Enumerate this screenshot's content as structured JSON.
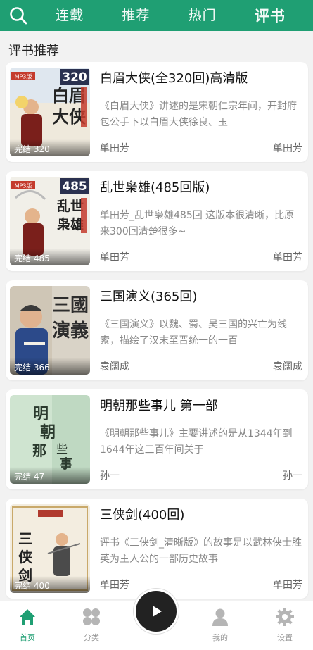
{
  "header": {
    "tabs": [
      {
        "label": "连载"
      },
      {
        "label": "推荐"
      },
      {
        "label": "热门"
      },
      {
        "label": "评书"
      }
    ],
    "active_tab": "评书",
    "accent_color": "#1f9f73"
  },
  "section": {
    "title": "评书推荐"
  },
  "books": [
    {
      "title": "白眉大侠(全320回)高清版",
      "description": "《白眉大侠》讲述的是宋朝仁宗年间，开封府包公手下以白眉大侠徐良、玉",
      "author": "单田芳",
      "narrator": "单田芳",
      "badge": "完结 320",
      "cover_text": "白眉大侠",
      "cover_tag": "MP3版",
      "cover_number": "320"
    },
    {
      "title": "乱世枭雄(485回版)",
      "description": "单田芳_乱世枭雄485回  这版本很清晰，比原来300回清楚很多~",
      "author": "单田芳",
      "narrator": "单田芳",
      "badge": "完结 485",
      "cover_text": "乱世枭雄",
      "cover_tag": "MP3版",
      "cover_number": "485"
    },
    {
      "title": "三国演义(365回)",
      "description": "《三国演义》以魏、蜀、吴三国的兴亡为线索，描绘了汉末至晋统一的一百",
      "author": "袁阔成",
      "narrator": "袁阔成",
      "badge": "完结 366",
      "cover_text": "三國演義"
    },
    {
      "title": "明朝那些事儿 第一部",
      "description": "《明朝那些事儿》主要讲述的是从1344年到1644年这三百年间关于",
      "author": "孙一",
      "narrator": "孙一",
      "badge": "完结 47",
      "cover_text": "明朝那些事儿"
    },
    {
      "title": "三侠剑(400回)",
      "description": "评书《三侠剑_清晰版》的故事是以武林侠士胜英为主人公的一部历史故事",
      "author": "单田芳",
      "narrator": "单田芳",
      "badge": "完结 400",
      "cover_text": "三侠剑"
    }
  ],
  "bottom_nav": {
    "items": [
      {
        "label": "首页",
        "icon": "home-icon"
      },
      {
        "label": "分类",
        "icon": "grid-icon"
      },
      {
        "label": "",
        "icon": "play-icon"
      },
      {
        "label": "我的",
        "icon": "user-icon"
      },
      {
        "label": "设置",
        "icon": "gear-icon"
      }
    ],
    "active": "首页"
  }
}
